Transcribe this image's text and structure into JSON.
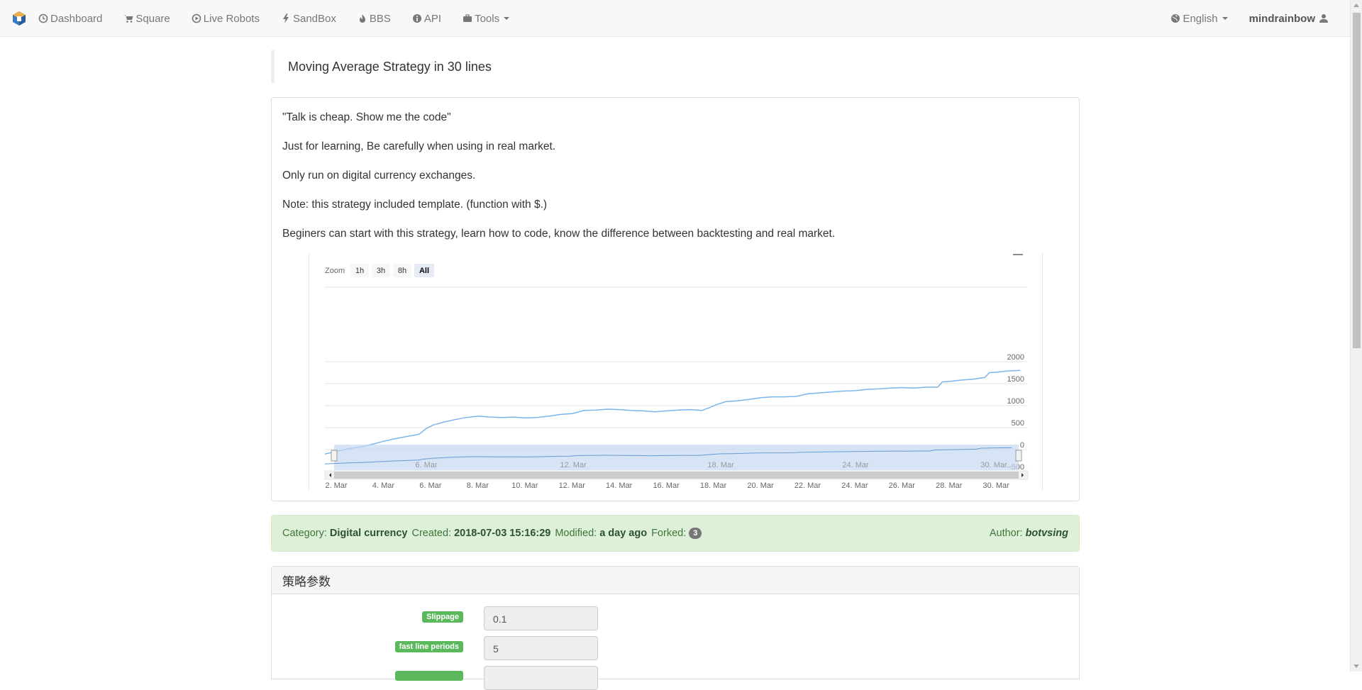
{
  "nav": {
    "items": [
      {
        "label": "Dashboard",
        "icon": "clock-icon"
      },
      {
        "label": "Square",
        "icon": "cart-icon"
      },
      {
        "label": "Live Robots",
        "icon": "play-circle-icon"
      },
      {
        "label": "SandBox",
        "icon": "lightning-icon"
      },
      {
        "label": "BBS",
        "icon": "fire-icon"
      },
      {
        "label": "API",
        "icon": "info-icon"
      },
      {
        "label": "Tools",
        "icon": "briefcase-icon"
      }
    ],
    "language": "English",
    "username": "mindrainbow"
  },
  "page": {
    "title": "Moving Average Strategy in 30 lines"
  },
  "description": [
    "\"Talk is cheap. Show me the code\"",
    "Just for learning, Be carefully when using in real market.",
    "Only run on digital currency exchanges.",
    "Note: this strategy included template. (function with $.)",
    "Beginers can start with this strategy, learn how to code, know the difference between backtesting and real market."
  ],
  "chart_data": {
    "type": "line",
    "zoom_label": "Zoom",
    "zoom_buttons": [
      "1h",
      "3h",
      "8h",
      "All"
    ],
    "zoom_selected": "All",
    "x_ticks": [
      "2. Mar",
      "4. Mar",
      "6. Mar",
      "8. Mar",
      "10. Mar",
      "12. Mar",
      "14. Mar",
      "16. Mar",
      "18. Mar",
      "20. Mar",
      "22. Mar",
      "24. Mar",
      "26. Mar",
      "28. Mar",
      "30. Mar"
    ],
    "y_ticks": [
      2000,
      1500,
      1000,
      500,
      0,
      -500
    ],
    "ylim": [
      -500,
      2000
    ],
    "navigator_ticks": [
      "6. Mar",
      "12. Mar",
      "18. Mar",
      "24. Mar",
      "30. Mar"
    ],
    "color": "#7cb5ec",
    "series": [
      {
        "x": [
          2,
          2.5,
          3,
          3.5,
          4,
          4.5,
          5,
          5.5,
          6,
          6.3,
          6.6,
          7,
          7.5,
          8,
          8.5,
          9,
          9.5,
          10,
          10.5,
          11,
          11.5,
          12,
          12.5,
          13,
          13.5,
          14,
          14.5,
          15,
          15.5,
          16,
          16.5,
          17,
          17.5,
          18,
          18.3,
          18.6,
          19,
          19.5,
          20,
          20.5,
          21,
          21.5,
          22,
          22.5,
          23,
          23.5,
          24,
          24.5,
          25,
          25.5,
          26,
          26.5,
          27,
          27.5,
          28,
          28.2,
          28.5,
          29,
          29.5,
          30,
          30.2,
          30.5,
          31,
          31.5
        ],
        "y": [
          -100,
          -40,
          20,
          60,
          120,
          190,
          250,
          300,
          350,
          480,
          560,
          620,
          680,
          730,
          760,
          740,
          730,
          740,
          720,
          730,
          760,
          800,
          820,
          890,
          900,
          920,
          910,
          890,
          880,
          860,
          880,
          900,
          910,
          890,
          950,
          1020,
          1090,
          1110,
          1140,
          1180,
          1200,
          1200,
          1210,
          1270,
          1290,
          1310,
          1330,
          1340,
          1370,
          1380,
          1400,
          1410,
          1400,
          1420,
          1420,
          1540,
          1550,
          1580,
          1600,
          1640,
          1750,
          1760,
          1790,
          1800
        ]
      }
    ]
  },
  "info": {
    "category_label": "Category:",
    "category": "Digital currency",
    "created_label": "Created:",
    "created": "2018-07-03 15:16:29",
    "modified_label": "Modified:",
    "modified": "a day ago",
    "forked_label": "Forked:",
    "forked": "3",
    "author_label": "Author:",
    "author": "botvsing"
  },
  "params": {
    "heading": "策略参数",
    "rows": [
      {
        "label": "Slippage",
        "value": "0.1"
      },
      {
        "label": "fast line periods",
        "value": "5"
      }
    ]
  }
}
